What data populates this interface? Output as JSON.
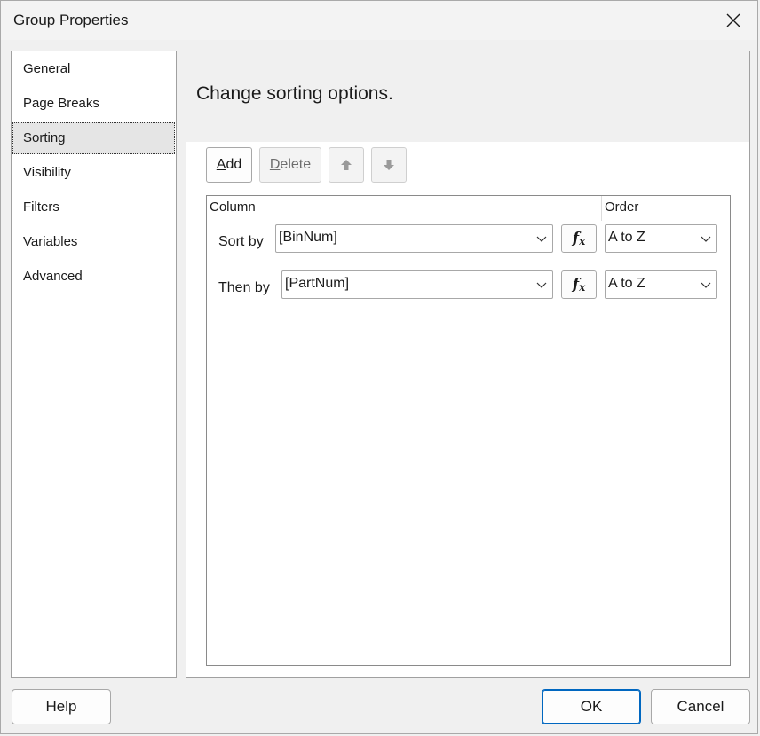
{
  "dialog": {
    "title": "Group Properties"
  },
  "nav": {
    "items": [
      {
        "label": "General"
      },
      {
        "label": "Page Breaks"
      },
      {
        "label": "Sorting",
        "selected": true
      },
      {
        "label": "Visibility"
      },
      {
        "label": "Filters"
      },
      {
        "label": "Variables"
      },
      {
        "label": "Advanced"
      }
    ]
  },
  "content": {
    "banner": "Change sorting options.",
    "toolbar": {
      "add_prefix": "A",
      "add_rest": "dd",
      "delete_prefix": "D",
      "delete_rest": "elete"
    },
    "grid": {
      "column_header": "Column",
      "order_header": "Order",
      "rows": [
        {
          "label": "Sort by",
          "column": "[BinNum]",
          "order": "A to Z"
        },
        {
          "label": "Then by",
          "column": "[PartNum]",
          "order": "A to Z"
        }
      ],
      "fx_label": "f",
      "fx_sub": "x"
    }
  },
  "buttons": {
    "help": "Help",
    "ok": "OK",
    "cancel": "Cancel"
  }
}
